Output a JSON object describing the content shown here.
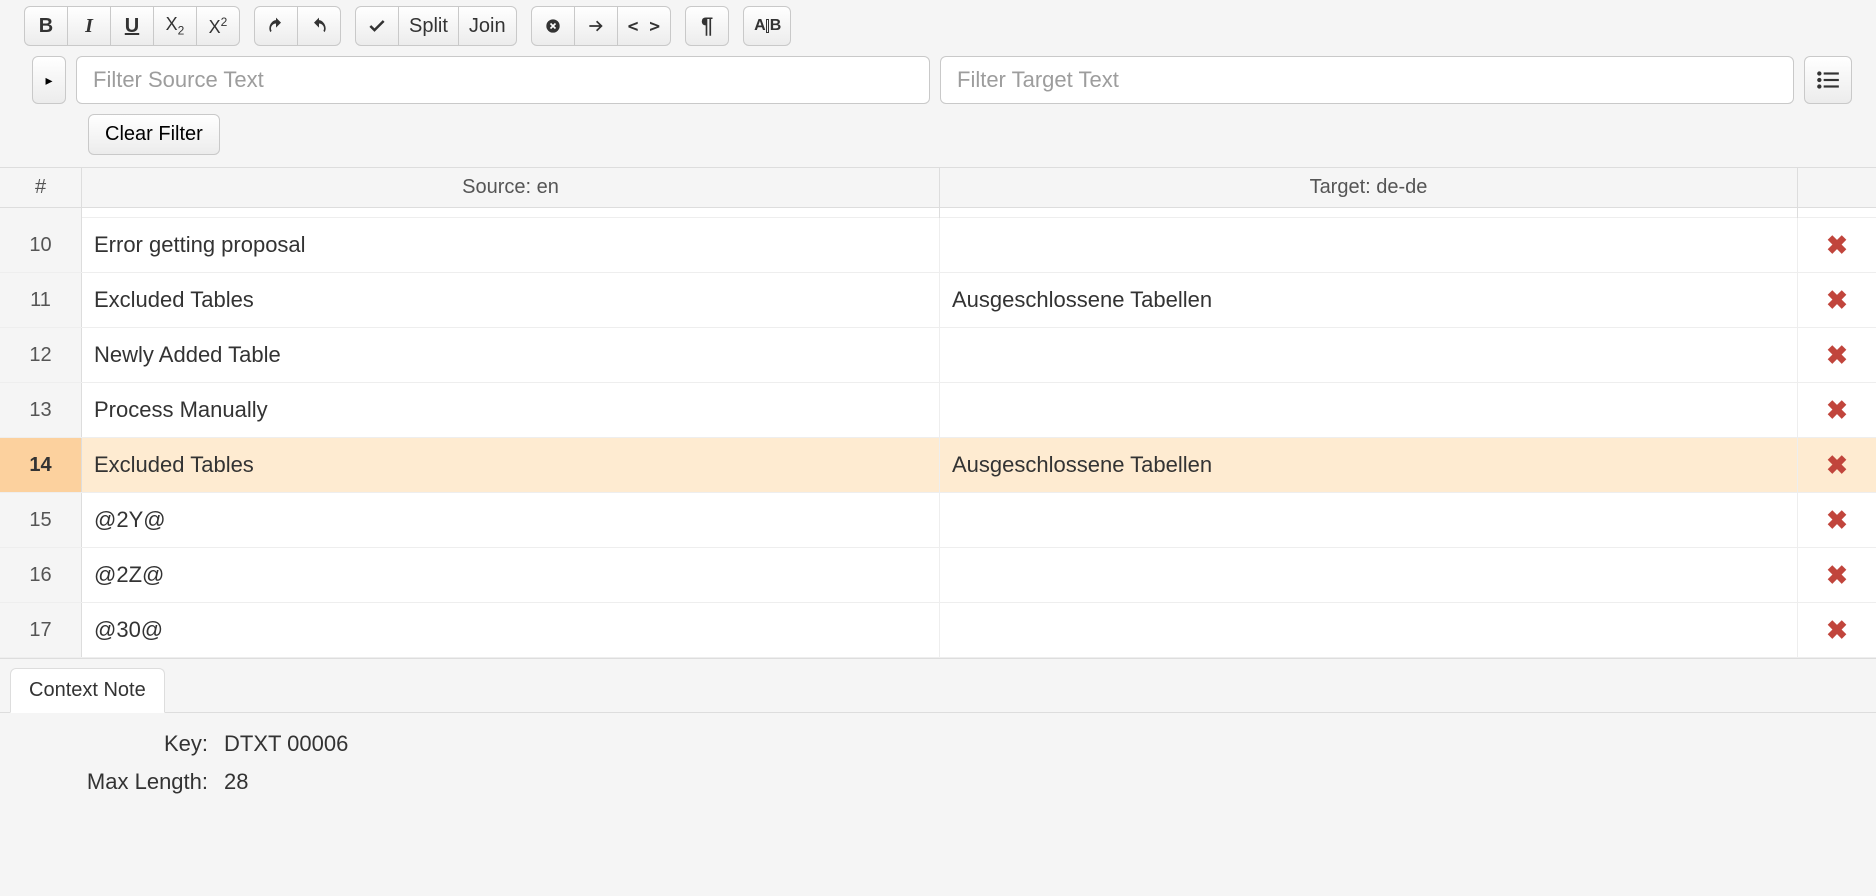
{
  "toolbar": {
    "bold": "B",
    "italic": "I",
    "underline": "U",
    "subscript_base": "X",
    "subscript_sub": "2",
    "superscript_base": "X",
    "superscript_sup": "2",
    "split_label": "Split",
    "join_label": "Join",
    "tag_angle": "< >",
    "tag_ab": "A⎮B"
  },
  "filter": {
    "source_placeholder": "Filter Source Text",
    "target_placeholder": "Filter Target Text",
    "clear_label": "Clear Filter"
  },
  "columns": {
    "num": "#",
    "source": "Source: en",
    "target": "Target: de-de"
  },
  "rows": [
    {
      "n": "10",
      "src": "Error getting proposal",
      "tgt": "",
      "selected": false
    },
    {
      "n": "11",
      "src": "Excluded Tables",
      "tgt": "Ausgeschlossene Tabellen",
      "selected": false
    },
    {
      "n": "12",
      "src": "Newly Added Table",
      "tgt": "",
      "selected": false
    },
    {
      "n": "13",
      "src": "Process Manually",
      "tgt": "",
      "selected": false
    },
    {
      "n": "14",
      "src": "Excluded Tables",
      "tgt": "Ausgeschlossene Tabellen",
      "selected": true
    },
    {
      "n": "15",
      "src": "@2Y@",
      "tgt": "",
      "selected": false
    },
    {
      "n": "16",
      "src": "@2Z@",
      "tgt": "",
      "selected": false
    },
    {
      "n": "17",
      "src": "@30@",
      "tgt": "",
      "selected": false
    }
  ],
  "tabs": {
    "context_note": "Context Note"
  },
  "meta": {
    "key_label": "Key:",
    "key_value": "DTXT 00006",
    "maxlen_label": "Max Length:",
    "maxlen_value": "28"
  }
}
